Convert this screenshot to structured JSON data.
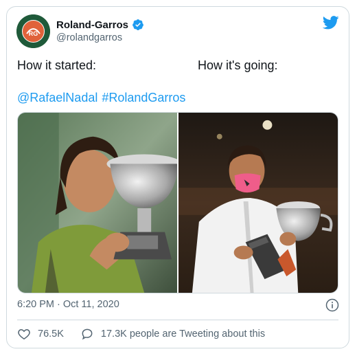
{
  "account": {
    "display_name": "Roland-Garros",
    "handle": "@rolandgarros",
    "avatar_logo_text": "ROLAND GARROS PARIS"
  },
  "tweet": {
    "text_left": "How it started:",
    "text_right": "How it's going:",
    "mention": "@RafaelNadal",
    "hashtag": "#RolandGarros"
  },
  "media": {
    "images": [
      {
        "semantic": "player-kissing-trophy-2005-photo"
      },
      {
        "semantic": "player-holding-trophy-2020-photo"
      }
    ]
  },
  "meta": {
    "time": "6:20 PM",
    "separator": "·",
    "date": "Oct 11, 2020"
  },
  "actions": {
    "likes": "76.5K",
    "tweeting": "17.3K people are Tweeting about this"
  },
  "colors": {
    "accent": "#1d9bf0",
    "text": "#0f1419",
    "muted": "#536471",
    "border": "#cfd9de",
    "brand_green": "#1f5a3a",
    "brand_orange": "#e0623a"
  },
  "icons": [
    "verified-badge-icon",
    "twitter-bird-icon",
    "info-icon",
    "heart-icon",
    "speech-bubble-icon"
  ]
}
